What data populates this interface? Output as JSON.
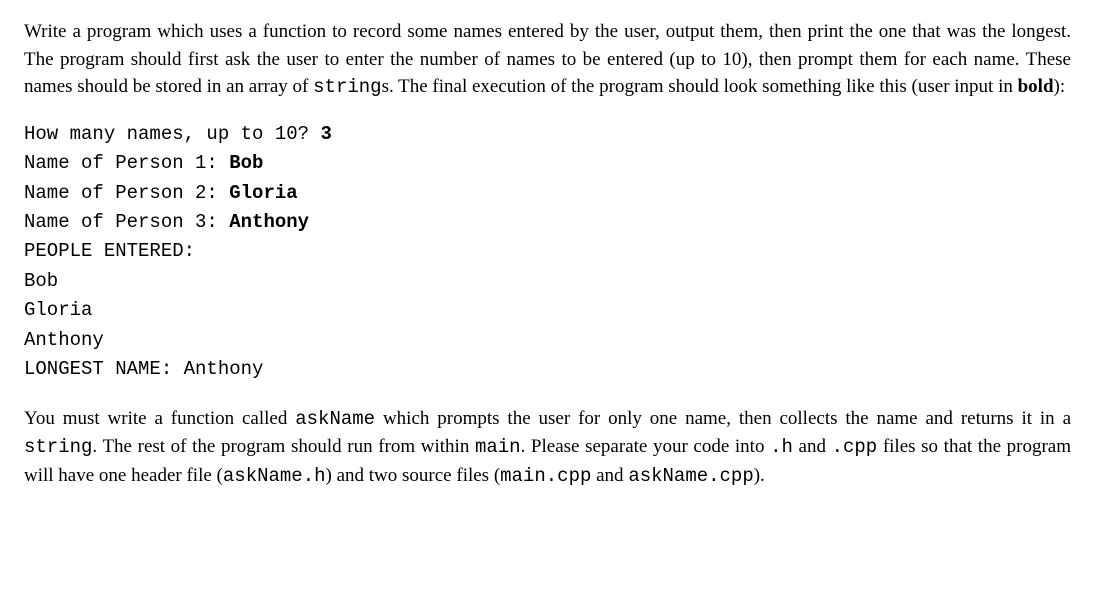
{
  "para1": {
    "t1": "Write a program which uses a function to record some names entered by the user, output them, then print the one that was the longest. The program should first ask the user to enter the number of names to be entered (up to 10), then prompt them for each name. These names should be stored in an array of ",
    "code1": "string",
    "t2": "s. The final execution of the program should look something like this (user input in ",
    "bold1": "bold",
    "t3": "):"
  },
  "term": {
    "l1a": "How many names, up to 10? ",
    "l1b": "3",
    "l2a": "Name of Person 1: ",
    "l2b": "Bob",
    "l3a": "Name of Person 2: ",
    "l3b": "Gloria",
    "l4a": "Name of Person 3: ",
    "l4b": "Anthony",
    "l5": "PEOPLE ENTERED:",
    "l6": "Bob",
    "l7": "Gloria",
    "l8": "Anthony",
    "l9": "LONGEST NAME: Anthony"
  },
  "para2": {
    "t1": "You must write a function called ",
    "code1": "askName",
    "t2": " which prompts the user for only one name, then collects the name and returns it in a ",
    "code2": "string",
    "t3": ". The rest of the program should run from within ",
    "code3": "main",
    "t4": ". Please separate your code into ",
    "code4": ".h",
    "t5": " and ",
    "code5": ".cpp",
    "t6": " files so that the program will have one header file (",
    "code6": "askName.h",
    "t7": ") and two source files (",
    "code7": "main.cpp",
    "t8": " and ",
    "code8": "askName.cpp",
    "t9": ")."
  }
}
